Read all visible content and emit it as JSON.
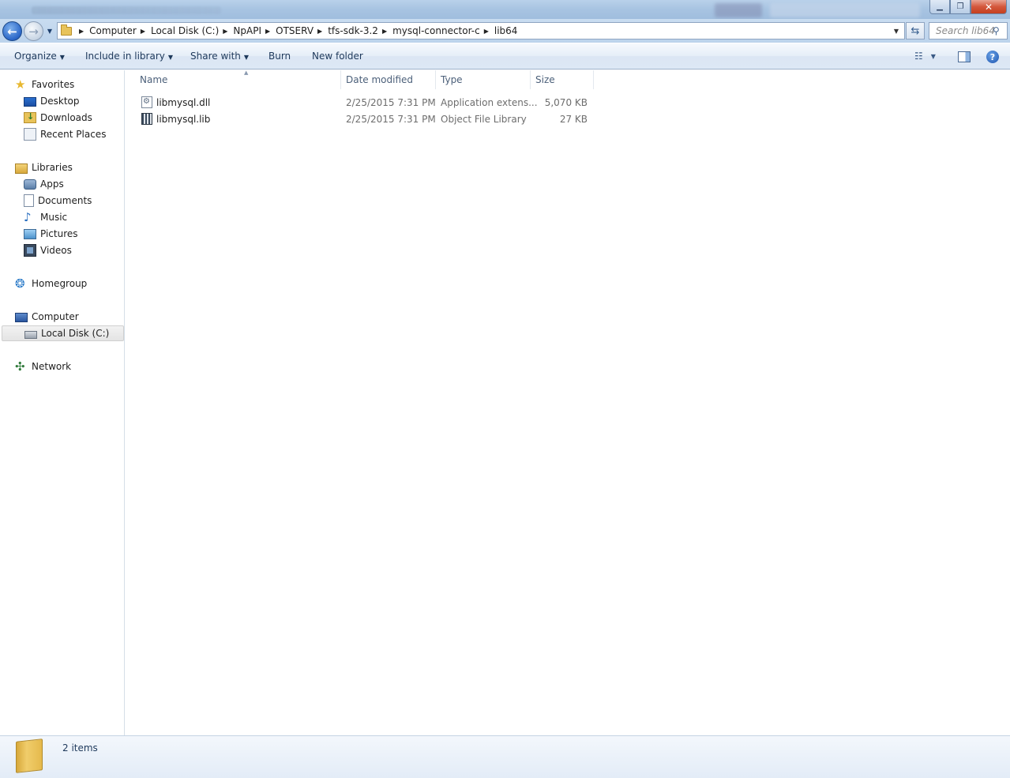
{
  "window": {
    "minimize_glyph": "▁",
    "maximize_glyph": "❐",
    "close_glyph": "✕"
  },
  "address": {
    "breadcrumbs": [
      "Computer",
      "Local Disk (C:)",
      "NpAPI",
      "OTSERV",
      "tfs-sdk-3.2",
      "mysql-connector-c",
      "lib64"
    ]
  },
  "search": {
    "placeholder": "Search lib64"
  },
  "toolbar": {
    "organize": "Organize",
    "include_in_library": "Include in library",
    "share_with": "Share with",
    "burn": "Burn",
    "new_folder": "New folder"
  },
  "nav": {
    "favorites": "Favorites",
    "desktop": "Desktop",
    "downloads": "Downloads",
    "recent_places": "Recent Places",
    "libraries": "Libraries",
    "apps": "Apps",
    "documents": "Documents",
    "music": "Music",
    "pictures": "Pictures",
    "videos": "Videos",
    "homegroup": "Homegroup",
    "computer": "Computer",
    "local_disk": "Local Disk (C:)",
    "network": "Network"
  },
  "columns": {
    "name": "Name",
    "date_modified": "Date modified",
    "type": "Type",
    "size": "Size"
  },
  "files": [
    {
      "name": "libmysql.dll",
      "date": "2/25/2015 7:31 PM",
      "type": "Application extens...",
      "size": "5,070 KB",
      "icon": "dll-file-icon"
    },
    {
      "name": "libmysql.lib",
      "date": "2/25/2015 7:31 PM",
      "type": "Object File Library",
      "size": "27 KB",
      "icon": "lib-file-icon"
    }
  ],
  "status": {
    "item_count": "2 items"
  },
  "colors": {
    "accent": "#1e395b",
    "titlebar": "#a8c4e2",
    "close_button": "#c4401f",
    "folder": "#e8c35a"
  }
}
